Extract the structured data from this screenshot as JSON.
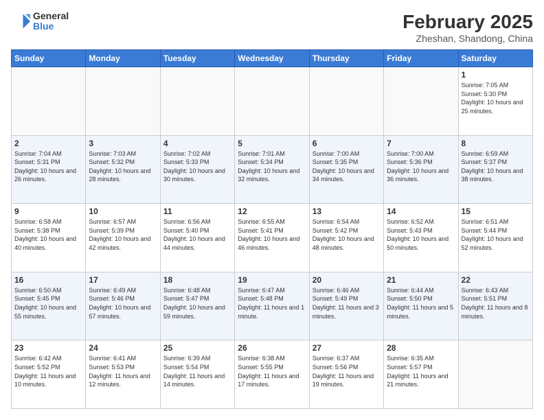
{
  "logo": {
    "general": "General",
    "blue": "Blue"
  },
  "title": "February 2025",
  "location": "Zheshan, Shandong, China",
  "days_of_week": [
    "Sunday",
    "Monday",
    "Tuesday",
    "Wednesday",
    "Thursday",
    "Friday",
    "Saturday"
  ],
  "weeks": [
    [
      {
        "day": "",
        "info": ""
      },
      {
        "day": "",
        "info": ""
      },
      {
        "day": "",
        "info": ""
      },
      {
        "day": "",
        "info": ""
      },
      {
        "day": "",
        "info": ""
      },
      {
        "day": "",
        "info": ""
      },
      {
        "day": "1",
        "info": "Sunrise: 7:05 AM\nSunset: 5:30 PM\nDaylight: 10 hours and 25 minutes."
      }
    ],
    [
      {
        "day": "2",
        "info": "Sunrise: 7:04 AM\nSunset: 5:31 PM\nDaylight: 10 hours and 26 minutes."
      },
      {
        "day": "3",
        "info": "Sunrise: 7:03 AM\nSunset: 5:32 PM\nDaylight: 10 hours and 28 minutes."
      },
      {
        "day": "4",
        "info": "Sunrise: 7:02 AM\nSunset: 5:33 PM\nDaylight: 10 hours and 30 minutes."
      },
      {
        "day": "5",
        "info": "Sunrise: 7:01 AM\nSunset: 5:34 PM\nDaylight: 10 hours and 32 minutes."
      },
      {
        "day": "6",
        "info": "Sunrise: 7:00 AM\nSunset: 5:35 PM\nDaylight: 10 hours and 34 minutes."
      },
      {
        "day": "7",
        "info": "Sunrise: 7:00 AM\nSunset: 5:36 PM\nDaylight: 10 hours and 36 minutes."
      },
      {
        "day": "8",
        "info": "Sunrise: 6:59 AM\nSunset: 5:37 PM\nDaylight: 10 hours and 38 minutes."
      }
    ],
    [
      {
        "day": "9",
        "info": "Sunrise: 6:58 AM\nSunset: 5:38 PM\nDaylight: 10 hours and 40 minutes."
      },
      {
        "day": "10",
        "info": "Sunrise: 6:57 AM\nSunset: 5:39 PM\nDaylight: 10 hours and 42 minutes."
      },
      {
        "day": "11",
        "info": "Sunrise: 6:56 AM\nSunset: 5:40 PM\nDaylight: 10 hours and 44 minutes."
      },
      {
        "day": "12",
        "info": "Sunrise: 6:55 AM\nSunset: 5:41 PM\nDaylight: 10 hours and 46 minutes."
      },
      {
        "day": "13",
        "info": "Sunrise: 6:54 AM\nSunset: 5:42 PM\nDaylight: 10 hours and 48 minutes."
      },
      {
        "day": "14",
        "info": "Sunrise: 6:52 AM\nSunset: 5:43 PM\nDaylight: 10 hours and 50 minutes."
      },
      {
        "day": "15",
        "info": "Sunrise: 6:51 AM\nSunset: 5:44 PM\nDaylight: 10 hours and 52 minutes."
      }
    ],
    [
      {
        "day": "16",
        "info": "Sunrise: 6:50 AM\nSunset: 5:45 PM\nDaylight: 10 hours and 55 minutes."
      },
      {
        "day": "17",
        "info": "Sunrise: 6:49 AM\nSunset: 5:46 PM\nDaylight: 10 hours and 57 minutes."
      },
      {
        "day": "18",
        "info": "Sunrise: 6:48 AM\nSunset: 5:47 PM\nDaylight: 10 hours and 59 minutes."
      },
      {
        "day": "19",
        "info": "Sunrise: 6:47 AM\nSunset: 5:48 PM\nDaylight: 11 hours and 1 minute."
      },
      {
        "day": "20",
        "info": "Sunrise: 6:46 AM\nSunset: 5:49 PM\nDaylight: 11 hours and 3 minutes."
      },
      {
        "day": "21",
        "info": "Sunrise: 6:44 AM\nSunset: 5:50 PM\nDaylight: 11 hours and 5 minutes."
      },
      {
        "day": "22",
        "info": "Sunrise: 6:43 AM\nSunset: 5:51 PM\nDaylight: 11 hours and 8 minutes."
      }
    ],
    [
      {
        "day": "23",
        "info": "Sunrise: 6:42 AM\nSunset: 5:52 PM\nDaylight: 11 hours and 10 minutes."
      },
      {
        "day": "24",
        "info": "Sunrise: 6:41 AM\nSunset: 5:53 PM\nDaylight: 11 hours and 12 minutes."
      },
      {
        "day": "25",
        "info": "Sunrise: 6:39 AM\nSunset: 5:54 PM\nDaylight: 11 hours and 14 minutes."
      },
      {
        "day": "26",
        "info": "Sunrise: 6:38 AM\nSunset: 5:55 PM\nDaylight: 11 hours and 17 minutes."
      },
      {
        "day": "27",
        "info": "Sunrise: 6:37 AM\nSunset: 5:56 PM\nDaylight: 11 hours and 19 minutes."
      },
      {
        "day": "28",
        "info": "Sunrise: 6:35 AM\nSunset: 5:57 PM\nDaylight: 11 hours and 21 minutes."
      },
      {
        "day": "",
        "info": ""
      }
    ]
  ]
}
